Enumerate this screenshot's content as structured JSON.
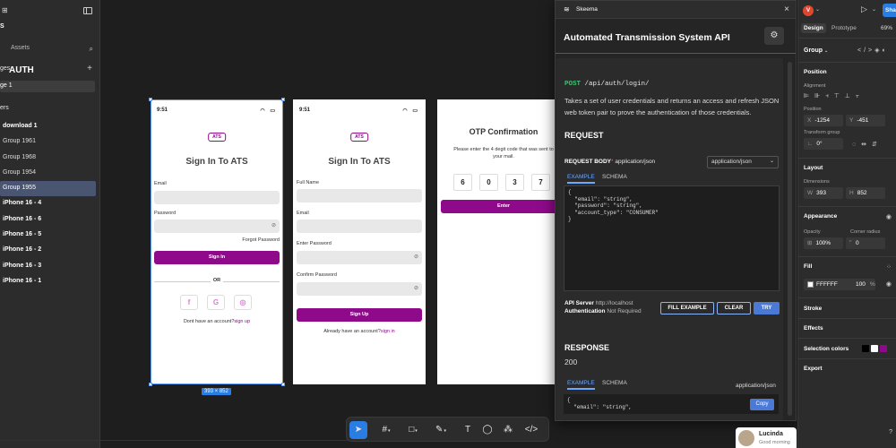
{
  "left_panel": {
    "project_initial": "S",
    "tabs": {
      "layers": "",
      "assets": "Assets"
    },
    "pages_header": "ges",
    "page_item": "ge 1",
    "layers_header": "ers",
    "layers": [
      {
        "label": "download 1",
        "bold": true
      },
      {
        "label": "Group 1961"
      },
      {
        "label": "Group 1968"
      },
      {
        "label": "Group 1954"
      },
      {
        "label": "Group 1955",
        "selected": true
      },
      {
        "label": "iPhone 16 - 4",
        "bold": true
      },
      {
        "label": "iPhone 16 - 6",
        "bold": true
      },
      {
        "label": "iPhone 16 - 5",
        "bold": true
      },
      {
        "label": "iPhone 16 - 2",
        "bold": true
      },
      {
        "label": "iPhone 16 - 3",
        "bold": true
      },
      {
        "label": "iPhone 16 - 1",
        "bold": true
      }
    ]
  },
  "frames": {
    "signin": {
      "time": "9:51",
      "badge": "ATS",
      "title": "Sign In To ATS",
      "email_label": "Email",
      "password_label": "Password",
      "forgot": "Forgot Password",
      "button": "Sign In",
      "or": "OR",
      "social": [
        "f",
        "G",
        "◎"
      ],
      "bottom_text": "Dont have an account?",
      "bottom_link": "sign up"
    },
    "signup": {
      "time": "9:51",
      "badge": "ATS",
      "title": "Sign In To ATS",
      "fullname_label": "Full Name",
      "email_label": "Email",
      "password_label": "Enter Password",
      "confirm_label": "Confirm Password",
      "button": "Sign Up",
      "bottom_text": "Already have an account?",
      "bottom_link": "sign in"
    },
    "otp": {
      "title": "OTP Confirmation",
      "subtitle": "Please enter the 4 degit code that was sent to your mail.",
      "digits": [
        "6",
        "0",
        "3",
        "7"
      ],
      "button": "Enter"
    }
  },
  "selection_dims": "393 × 852",
  "plugin": {
    "name": "Skeema",
    "api_title": "Automated Transmission System API",
    "section": "AUTH",
    "method": "POST",
    "path": "/api/auth/login/",
    "description": "Takes a set of user credentials and returns an access and refresh JSON web token pair to prove the authentication of those credentials.",
    "request_header": "REQUEST",
    "request_body_label": "REQUEST BODY",
    "request_required_mark": "*",
    "request_ctype": "application/json",
    "ctype_select": "application/json",
    "tabs": {
      "example": "EXAMPLE",
      "schema": "SCHEMA"
    },
    "request_example": "{\n  \"email\": \"string\",\n  \"password\": \"string\",\n  \"account_type\": \"CONSUMER\"\n}",
    "api_server_label": "API Server",
    "api_server_value": "http://localhost",
    "auth_label": "Authentication",
    "auth_value": "Not Required",
    "buttons": {
      "fill": "FILL EXAMPLE",
      "clear": "CLEAR",
      "try": "TRY"
    },
    "response_header": "RESPONSE",
    "status_code": "200",
    "response_ctype": "application/json",
    "response_example": "{\n  \"email\": \"string\",",
    "copy": "Copy"
  },
  "comment": {
    "name": "Lucinda",
    "subtitle": "Good morning"
  },
  "right_panel": {
    "avatar": "V",
    "share": "Sha",
    "tabs": {
      "design": "Design",
      "prototype": "Prototype"
    },
    "zoom": "69%",
    "group_label": "Group",
    "position": "Position",
    "alignment": "Alignment",
    "position_sub": "Position",
    "x": "-1254",
    "y": "-451",
    "transform": "Transform group",
    "rotation": "0°",
    "layout": "Layout",
    "dimensions": "Dimensions",
    "w": "393",
    "h": "852",
    "appearance": "Appearance",
    "opacity_label": "Opacity",
    "corner_label": "Corner radius",
    "opacity": "100%",
    "corner": "0",
    "fill": "Fill",
    "fill_hex": "FFFFFF",
    "fill_opacity": "100",
    "fill_pct": "%",
    "stroke": "Stroke",
    "effects": "Effects",
    "selection_colors": "Selection colors",
    "selection_swatches": [
      "#000000",
      "#ffffff",
      "#8e0a8a"
    ],
    "export": "Export"
  },
  "colors": {
    "accent": "#8e0a8a",
    "selection": "#2a7de1"
  }
}
